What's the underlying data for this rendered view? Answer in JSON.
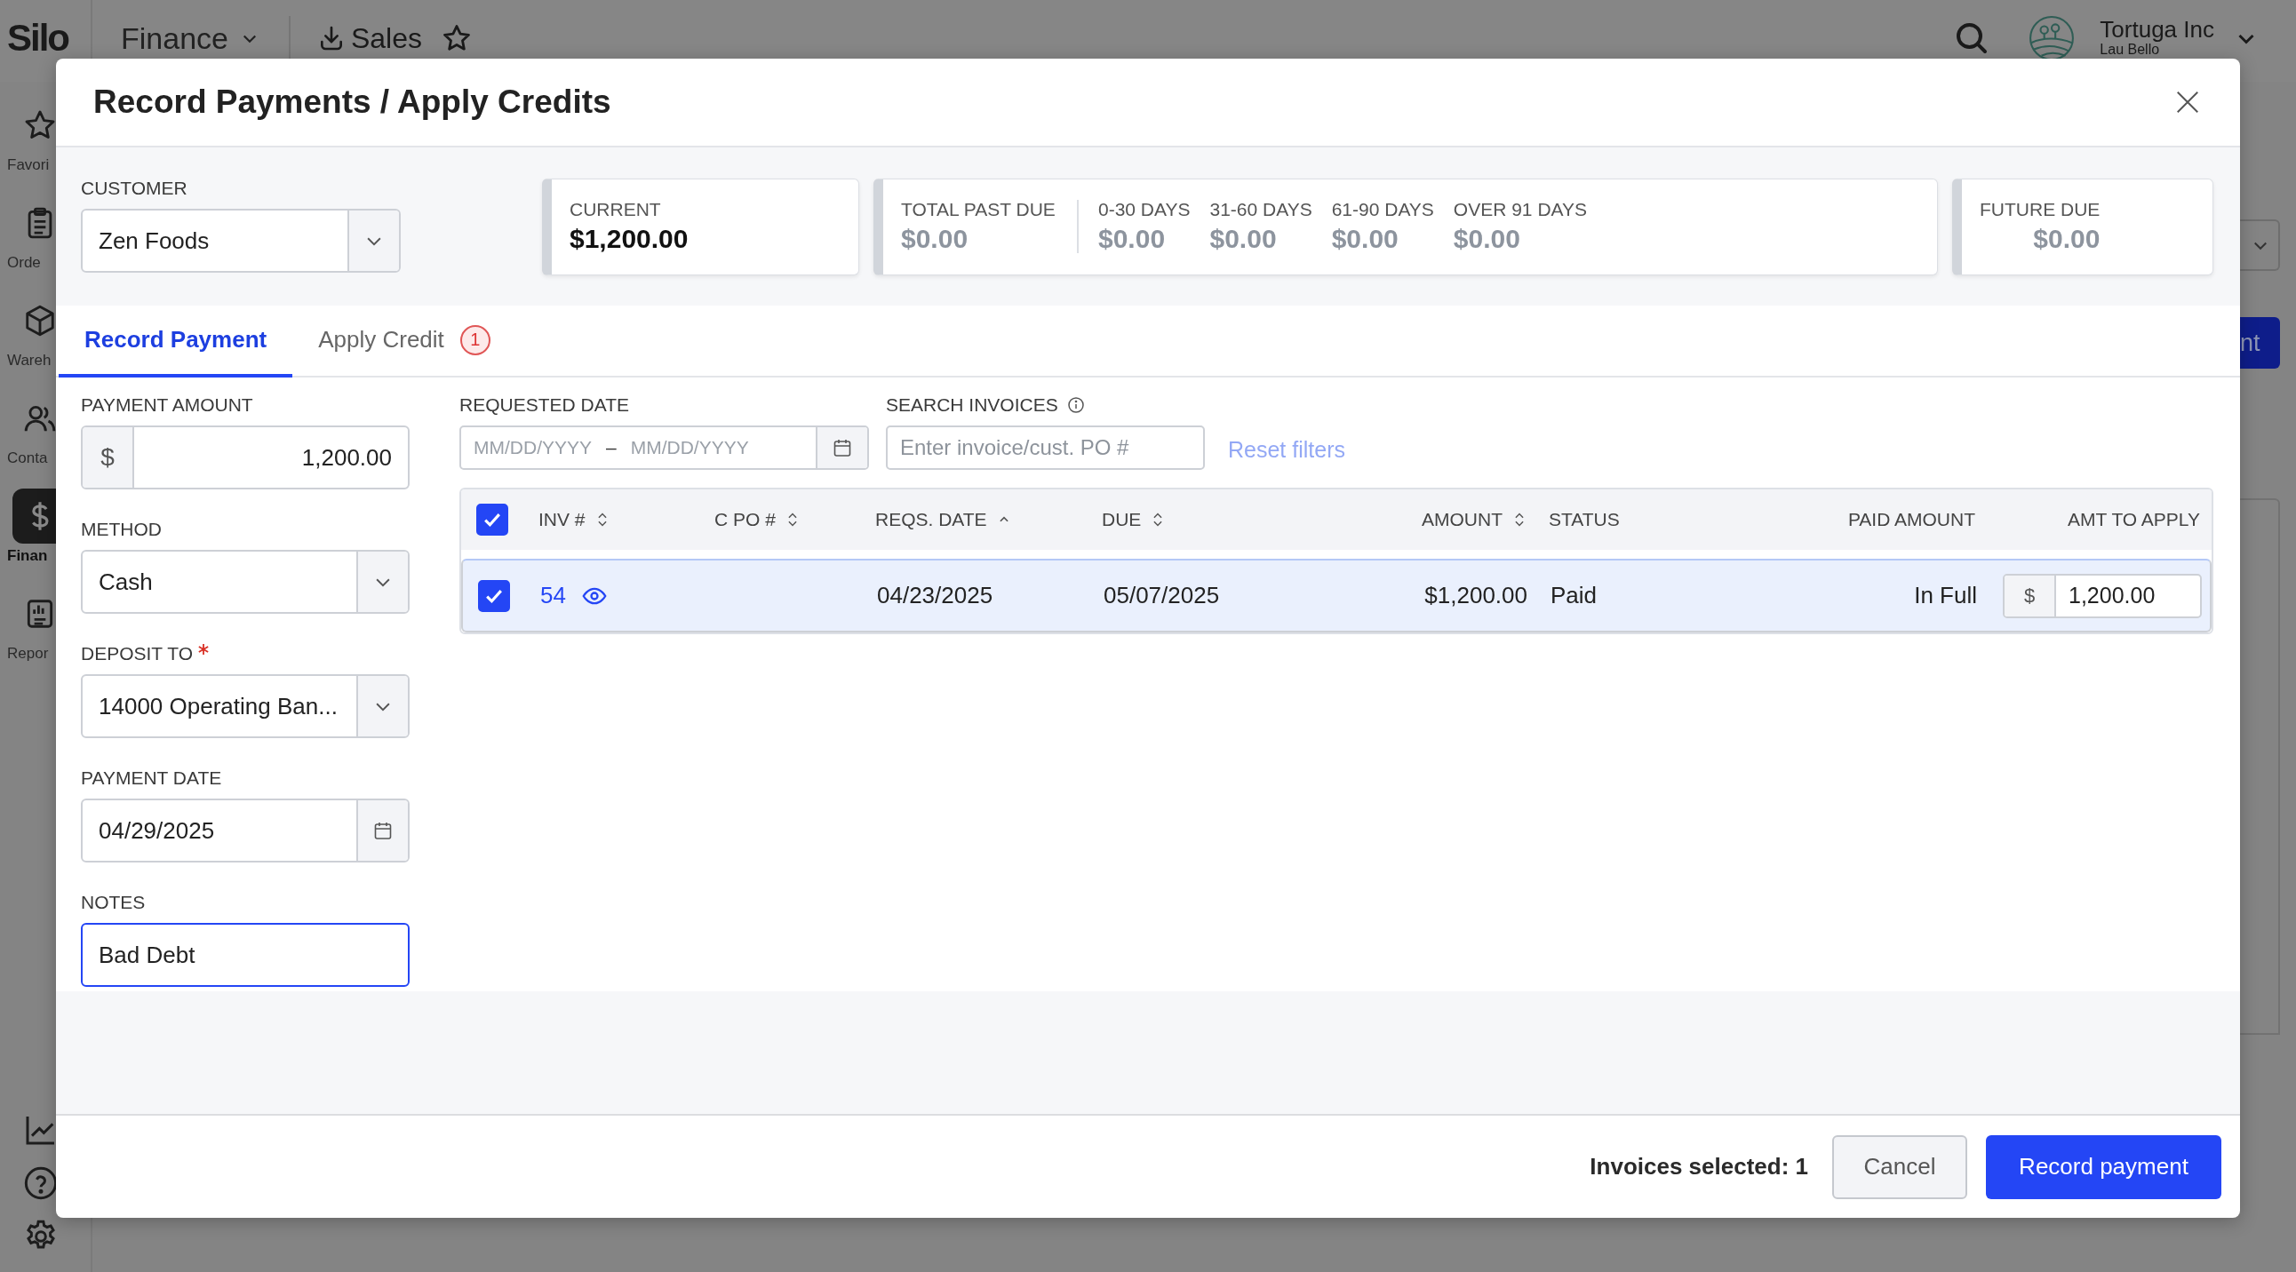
{
  "app_bar": {
    "logo": "Silo",
    "module": "Finance",
    "page": "Sales",
    "company": "Tortuga Inc",
    "user": "Lau Bello"
  },
  "sidebar": {
    "items": [
      {
        "kind": "star",
        "label": "Favori",
        "selected": false
      },
      {
        "kind": "clipboard",
        "label": "Orde",
        "selected": false
      },
      {
        "kind": "cube",
        "label": "Wareh",
        "selected": false
      },
      {
        "kind": "people",
        "label": "Conta",
        "selected": false
      },
      {
        "kind": "dollar",
        "label": "Finan",
        "selected": true
      },
      {
        "kind": "report",
        "label": "Repor",
        "selected": false
      }
    ]
  },
  "background": {
    "button_text": "nt"
  },
  "dialog": {
    "title": "Record Payments / Apply Credits",
    "customer": {
      "label": "CUSTOMER",
      "value": "Zen Foods"
    },
    "summary_cards": [
      {
        "kind": "current",
        "items": [
          {
            "label": "CURRENT",
            "value": "$1,200.00",
            "highlighted": true
          }
        ]
      },
      {
        "kind": "aging",
        "items": [
          {
            "label": "TOTAL PAST DUE",
            "value": "$0.00",
            "highlighted": false
          },
          {
            "label": "0-30 DAYS",
            "value": "$0.00",
            "highlighted": false
          },
          {
            "label": "31-60 DAYS",
            "value": "$0.00",
            "highlighted": false
          },
          {
            "label": "61-90 DAYS",
            "value": "$0.00",
            "highlighted": false
          },
          {
            "label": "OVER 91 DAYS",
            "value": "$0.00",
            "highlighted": false
          }
        ]
      },
      {
        "kind": "future",
        "items": [
          {
            "label": "FUTURE DUE",
            "value": "$0.00",
            "highlighted": false
          }
        ]
      }
    ],
    "tabs": [
      {
        "label": "Record Payment",
        "selected": true
      },
      {
        "label": "Apply Credit",
        "selected": false,
        "badge": "1"
      }
    ],
    "form": {
      "payment_amount": {
        "label": "PAYMENT AMOUNT",
        "prefix": "$",
        "value": "1,200.00"
      },
      "method": {
        "label": "METHOD",
        "value": "Cash"
      },
      "deposit_to": {
        "label": "DEPOSIT TO",
        "required": true,
        "value": "14000 Operating Ban..."
      },
      "payment_date": {
        "label": "PAYMENT DATE",
        "value": "04/29/2025"
      },
      "notes": {
        "label": "NOTES",
        "value": "Bad Debt",
        "focused": true
      }
    },
    "filters": {
      "requested_date": {
        "label": "REQUESTED DATE",
        "from_placeholder": "MM/DD/YYYY",
        "separator": "–",
        "to_placeholder": "MM/DD/YYYY"
      },
      "search": {
        "label": "SEARCH INVOICES",
        "placeholder": "Enter invoice/cust. PO #"
      },
      "reset": "Reset filters"
    },
    "table": {
      "all_checked": true,
      "columns": [
        {
          "label": "INV #",
          "kind": "sortable"
        },
        {
          "label": "C PO #",
          "kind": "sortable"
        },
        {
          "label": "REQS. DATE",
          "kind": "sorted"
        },
        {
          "label": "DUE",
          "kind": "sortable"
        },
        {
          "label": "AMOUNT",
          "kind": "sortable"
        },
        {
          "label": "STATUS",
          "kind": "plain"
        },
        {
          "label": "PAID AMOUNT",
          "kind": "plain"
        },
        {
          "label": "AMT TO APPLY",
          "kind": "plain"
        }
      ],
      "rows": [
        {
          "selected": true,
          "inv": "54",
          "reqs_date": "04/23/2025",
          "due": "05/07/2025",
          "amount": "$1,200.00",
          "status": "Paid",
          "paid_amount": "In Full",
          "apply_prefix": "$",
          "apply_value": "1,200.00"
        }
      ]
    },
    "footer": {
      "summary": "Invoices selected: 1",
      "cancel": "Cancel",
      "submit": "Record payment"
    }
  }
}
